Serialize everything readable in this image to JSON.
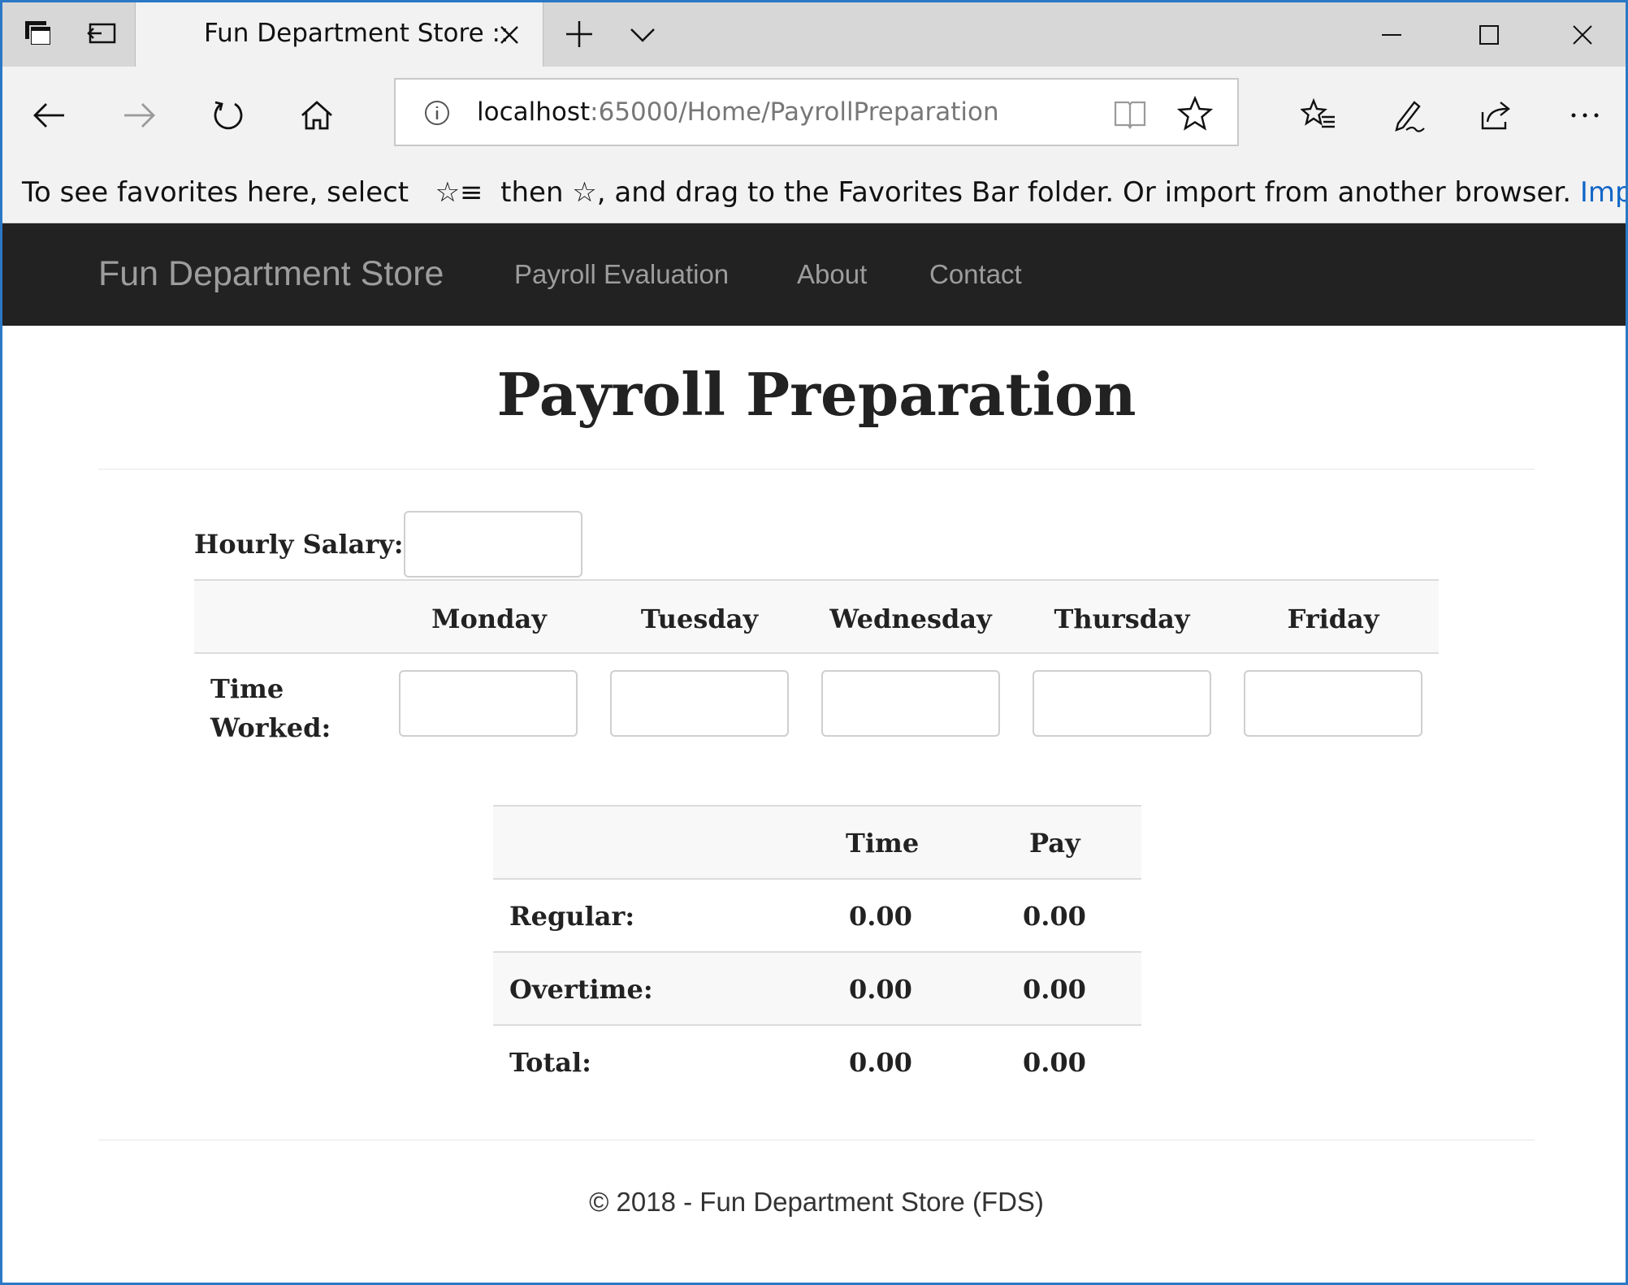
{
  "browser": {
    "tab_title": "Fun Department Store ::",
    "address_host": "localhost",
    "address_rest": ":65000/Home/PayrollPreparation",
    "favorites_message": "To see favorites here, select",
    "favorites_message_2": "then ☆, and drag to the Favorites Bar folder. Or import from another browser.",
    "favorites_link": "Import fav"
  },
  "navbar": {
    "brand": "Fun Department Store",
    "links": [
      "Payroll Evaluation",
      "About",
      "Contact"
    ]
  },
  "page": {
    "title": "Payroll Preparation",
    "hourly_salary_label": "Hourly Salary:",
    "hourly_salary_value": "",
    "days": [
      "Monday",
      "Tuesday",
      "Wednesday",
      "Thursday",
      "Friday"
    ],
    "time_worked_label_1": "Time",
    "time_worked_label_2": "Worked:",
    "time_worked_values": [
      "",
      "",
      "",
      "",
      ""
    ]
  },
  "summary": {
    "headers": [
      "",
      "Time",
      "Pay"
    ],
    "rows": [
      {
        "label": "Regular:",
        "time": "0.00",
        "pay": "0.00"
      },
      {
        "label": "Overtime:",
        "time": "0.00",
        "pay": "0.00"
      },
      {
        "label": "Total:",
        "time": "0.00",
        "pay": "0.00"
      }
    ]
  },
  "footer": {
    "text": "© 2018 - Fun Department Store (FDS)"
  }
}
